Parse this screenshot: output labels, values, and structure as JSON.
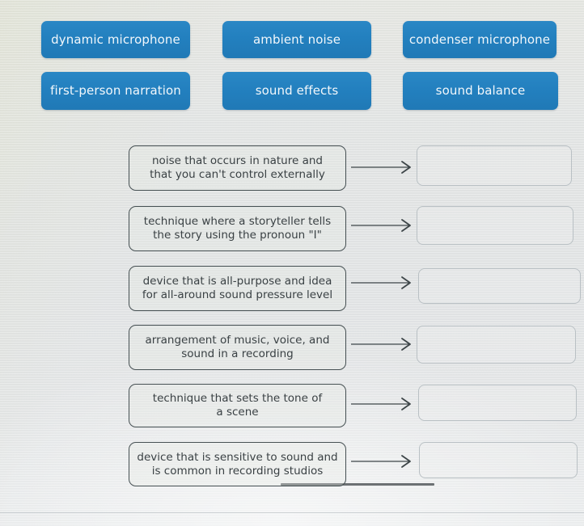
{
  "exercise": {
    "type": "drag-and-drop-matching",
    "colors": {
      "chip_blue": "#2380bf",
      "chip_text": "#f2f7fb",
      "definition_border": "#454f52",
      "definition_text": "#3a4144",
      "dropbox_border": "#b9c0c4",
      "page_background": "#e4e6e6",
      "arrow": "#3d4548"
    },
    "word_bank": {
      "label": "word-bank",
      "items": [
        {
          "id": "chip-dynamic-microphone",
          "label": "dynamic microphone",
          "row": 1,
          "col": 1
        },
        {
          "id": "chip-ambient-noise",
          "label": "ambient noise",
          "row": 1,
          "col": 2
        },
        {
          "id": "chip-condenser-microphone",
          "label": "condenser microphone",
          "row": 1,
          "col": 3
        },
        {
          "id": "chip-first-person-narration",
          "label": "first-person narration",
          "row": 2,
          "col": 1
        },
        {
          "id": "chip-sound-effects",
          "label": "sound effects",
          "row": 2,
          "col": 2
        },
        {
          "id": "chip-sound-balance",
          "label": "sound balance",
          "row": 2,
          "col": 3
        }
      ]
    },
    "rows": [
      {
        "id": "row-1",
        "definition_lines": [
          "noise that occurs in nature and",
          "that you can't control externally"
        ],
        "answer": ""
      },
      {
        "id": "row-2",
        "definition_lines": [
          "technique where a storyteller tells",
          "the story using the pronoun \"I\""
        ],
        "answer": ""
      },
      {
        "id": "row-3",
        "definition_lines": [
          "device that is all-purpose and idea",
          "for all-around sound pressure level"
        ],
        "answer": ""
      },
      {
        "id": "row-4",
        "definition_lines": [
          "arrangement of music, voice, and",
          "sound in a recording"
        ],
        "answer": ""
      },
      {
        "id": "row-5",
        "definition_lines": [
          "technique that sets the tone of",
          "a scene"
        ],
        "answer": ""
      },
      {
        "id": "row-6",
        "definition_lines": [
          "device that is sensitive to sound and",
          "is common in recording studios"
        ],
        "answer": ""
      }
    ]
  }
}
